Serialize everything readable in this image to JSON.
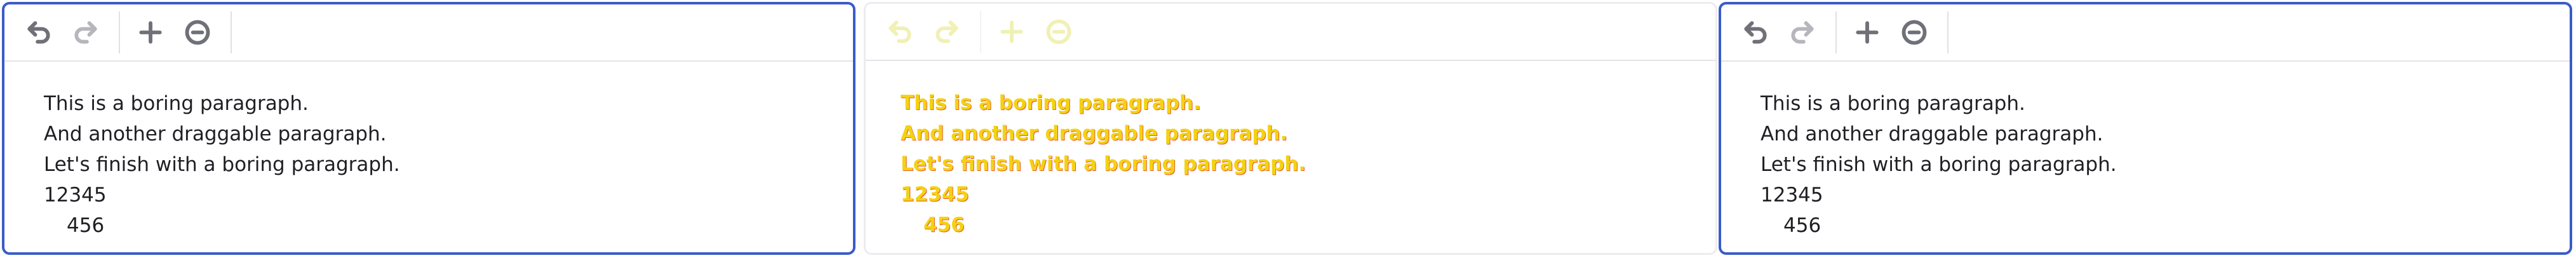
{
  "toolbar": {
    "icons": [
      "undo-icon",
      "redo-icon",
      "plus-icon",
      "minus-circle-icon"
    ]
  },
  "paragraphs": [
    "This is a boring paragraph.",
    "And another draggable paragraph.",
    "Let's finish with a boring paragraph.",
    "12345",
    "456"
  ],
  "colors": {
    "focus_border": "#3a5cc8",
    "text": "#1f1f24",
    "drag_ghost_text": "#f3cf00",
    "drag_ghost_outline": "#e84a2c"
  }
}
